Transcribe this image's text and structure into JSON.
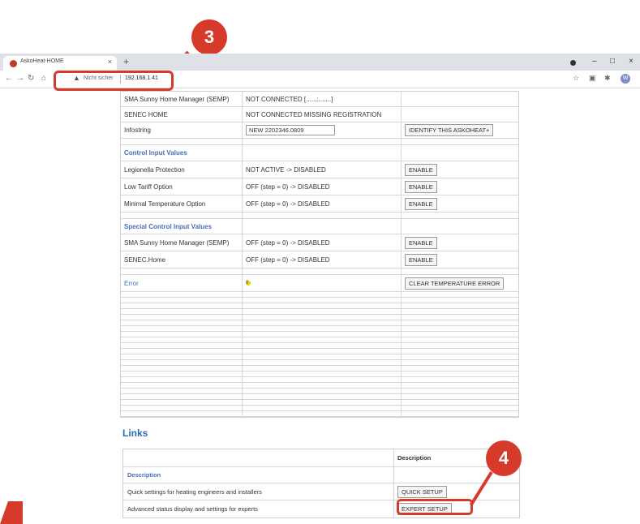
{
  "browser": {
    "tab_title": "AskoHeat-HOME",
    "tab_close": "×",
    "new_tab": "+",
    "not_secure": "Nicht sicher",
    "url": "192.168.1.41",
    "window_min": "–",
    "window_max": "□",
    "window_close": "×",
    "avatar_letter": "W"
  },
  "callouts": {
    "step3": "3",
    "step4": "4"
  },
  "rows": [
    {
      "c1": "SMA Sunny Home Manager (SEMP)",
      "c2": "NOT CONNECTED [......:.......]",
      "c3": ""
    },
    {
      "c1": "SENEC HOME",
      "c2": "NOT CONNECTED MISSING REGISTRATION",
      "c3": ""
    },
    {
      "c1": "Infostring",
      "c2": "NEW 2202346.0809",
      "c3": "IDENTIFY THIS ASKOHEAT+"
    },
    {
      "c1": "Control Input Values",
      "c2": "",
      "c3": ""
    },
    {
      "c1": "Legionella Protection",
      "c2": "NOT ACTIVE -> DISABLED",
      "c3": "ENABLE"
    },
    {
      "c1": "Low Tariff Option",
      "c2": "OFF (step = 0) -> DISABLED",
      "c3": "ENABLE"
    },
    {
      "c1": "Minimal Temperature Option",
      "c2": "OFF (step = 0) -> DISABLED",
      "c3": "ENABLE"
    },
    {
      "c1": "Special Control Input Values",
      "c2": "",
      "c3": ""
    },
    {
      "c1": "SMA Sunny Home Manager (SEMP)",
      "c2": "OFF (step = 0) -> DISABLED",
      "c3": "ENABLE"
    },
    {
      "c1": "SENEC.Home",
      "c2": "OFF (step = 0) -> DISABLED",
      "c3": "ENABLE"
    },
    {
      "c1": "Error",
      "c2": "0",
      "c3": "CLEAR TEMPERATURE ERROR"
    }
  ],
  "links": {
    "title": "Links",
    "header_description": "Description",
    "section": "Description",
    "quick_text": "Quick settings for heating engineers and installers",
    "quick_button": "QUICK SETUP",
    "expert_text": "Advanced status display and settings for experts",
    "expert_button": "EXPERT SETUP"
  }
}
